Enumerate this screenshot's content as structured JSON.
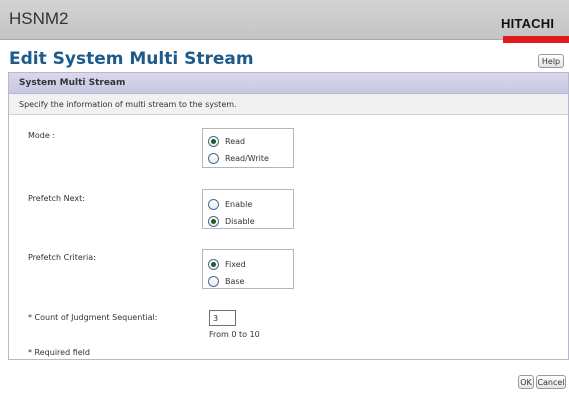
{
  "app": {
    "title": "HSNM2",
    "brand": "HITACHI",
    "brand_color": "#e11b1b"
  },
  "page": {
    "title": "Edit System Multi Stream",
    "help_label": "Help",
    "title_color": "#1f5b8a"
  },
  "panel": {
    "title": "System Multi Stream",
    "description": "Specify the information of multi stream to the system."
  },
  "fields": {
    "mode": {
      "label": "Mode :",
      "options": [
        {
          "label": "Read",
          "checked": true
        },
        {
          "label": "Read/Write",
          "checked": false
        }
      ]
    },
    "prefetch_next": {
      "label": "Prefetch Next:",
      "options": [
        {
          "label": "Enable",
          "checked": false
        },
        {
          "label": "Disable",
          "checked": true
        }
      ]
    },
    "prefetch_criteria": {
      "label": "Prefetch Criteria:",
      "options": [
        {
          "label": "Fixed",
          "checked": true
        },
        {
          "label": "Base",
          "checked": false
        }
      ]
    },
    "count_judgment": {
      "label": "* Count of Judgment Sequential:",
      "value": "3",
      "hint": "From 0 to 10"
    }
  },
  "required_note": "* Required field",
  "footer": {
    "ok_label": "OK",
    "cancel_label": "Cancel"
  },
  "icons": [
    "radio-selected-icon",
    "radio-unselected-icon"
  ]
}
